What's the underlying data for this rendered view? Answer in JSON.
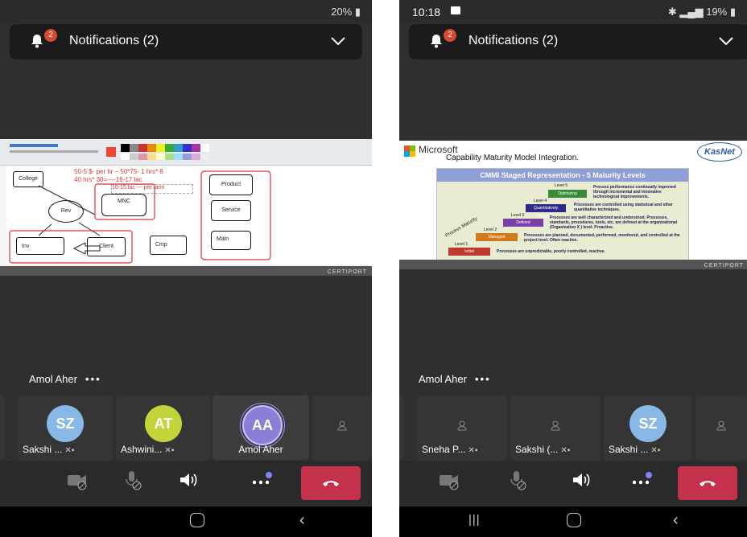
{
  "left": {
    "status": {
      "time": "",
      "battery": "20%"
    },
    "notifications": {
      "label": "Notifications (2)",
      "badge": "2"
    },
    "whiteboard": {
      "notes": [
        "50-5 $- per hr – 50*75- 1 hrs* 8",
        "40 hrs* 30=----16-17 lac",
        "10-15 lac --- per /ann"
      ],
      "boxes": [
        "College",
        "MNC",
        "Rev",
        "Inv",
        "Client",
        "Cmp",
        "Product",
        "Service",
        "Main"
      ],
      "brand": "CERTIPORT"
    },
    "speaker": {
      "name": "Amol Aher",
      "more": "•••"
    },
    "participants": [
      {
        "initials": "SZ",
        "name": "Sakshi ...",
        "color": "#87b8e6"
      },
      {
        "initials": "AT",
        "name": "Ashwini...",
        "color": "#c3d33a"
      },
      {
        "initials": "AA",
        "name": "Amol Aher",
        "color": "#8a7fd8"
      }
    ]
  },
  "right": {
    "status": {
      "time": "10:18",
      "battery": "19%"
    },
    "notifications": {
      "label": "Notifications (2)",
      "badge": "2"
    },
    "slide": {
      "company": "Microsoft",
      "subtitle": "Capability Maturity Model Integration.",
      "logo": "KasNet",
      "title": "CMMI Staged Representation - 5 Maturity Levels",
      "levels": [
        {
          "level": "Level 5",
          "name": "Optimizing",
          "desc": "Process performance continually improved through incremental and innovative technological improvements."
        },
        {
          "level": "Level 4",
          "name": "Quantitatively Managed",
          "desc": "Processes are controlled using statistical and other quantitative techniques."
        },
        {
          "level": "Level 3",
          "name": "Defined",
          "desc": "Processes are well characterized and understood. Processes, standards, procedures, tools, etc. are defined at the organizational (Organization X ) level. Proactive."
        },
        {
          "level": "Level 2",
          "name": "Managed",
          "desc": "Processes are planned, documented, performed, monitored, and controlled at the project level. Often reactive."
        },
        {
          "level": "Level 1",
          "name": "Initial",
          "desc": "Processes are unpredictable, poorly controlled, reactive."
        }
      ],
      "axis": "Process Maturity",
      "brand": "CERTIPORT"
    },
    "speaker": {
      "name": "Amol Aher",
      "more": "•••"
    },
    "participants": [
      {
        "initials": "",
        "name": "Sneha P..."
      },
      {
        "initials": "",
        "name": "Sakshi (..."
      },
      {
        "initials": "SZ",
        "name": "Sakshi ...",
        "color": "#87b8e6"
      }
    ]
  },
  "colors": {
    "endcall": "#c4314b",
    "badge": "#d64933",
    "accent": "#7f85f5"
  },
  "icons": [
    "bell-icon",
    "chevron-down-icon",
    "video-off-icon",
    "mic-off-icon",
    "speaker-icon",
    "more-icon",
    "hangup-icon",
    "person-icon"
  ]
}
